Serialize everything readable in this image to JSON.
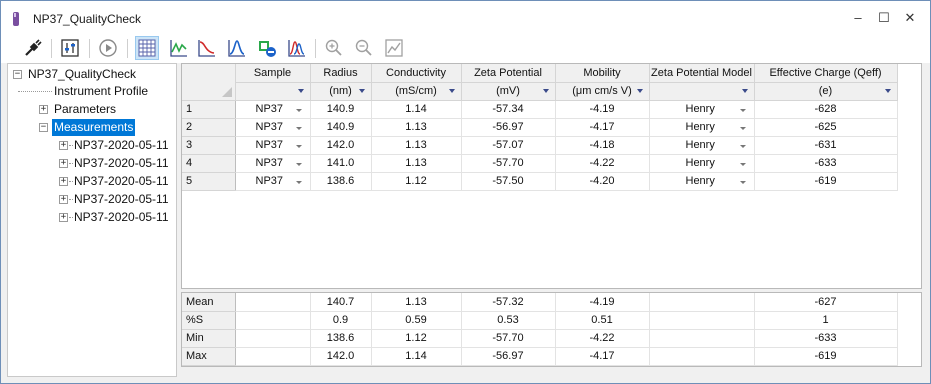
{
  "window": {
    "title": "NP37_QualityCheck",
    "minimize": "‒",
    "maximize": "☐",
    "close": "✕"
  },
  "toolbar": {
    "buttons": [
      {
        "name": "connect-icon",
        "active": false
      },
      {
        "name": "settings-sliders-icon",
        "active": false
      },
      {
        "name": "play-icon",
        "active": false
      },
      {
        "name": "grid-view-icon",
        "active": true
      },
      {
        "name": "trend-chart-icon",
        "active": false
      },
      {
        "name": "decay-chart-icon",
        "active": false
      },
      {
        "name": "peak-chart-icon",
        "active": false
      },
      {
        "name": "remove-data-icon",
        "active": false
      },
      {
        "name": "overlay-chart-icon",
        "active": false
      },
      {
        "name": "zoom-in-icon",
        "active": false
      },
      {
        "name": "zoom-out-icon",
        "active": false
      },
      {
        "name": "fit-chart-icon",
        "active": false
      }
    ]
  },
  "tree": {
    "root": "NP37_QualityCheck",
    "instrument_profile": "Instrument Profile",
    "parameters": "Parameters",
    "measurements": "Measurements",
    "measurement_items": [
      "NP37-2020-05-11",
      "NP37-2020-05-11",
      "NP37-2020-05-11",
      "NP37-2020-05-11",
      "NP37-2020-05-11"
    ]
  },
  "grid": {
    "columns": [
      "Sample",
      "Radius",
      "Conductivity",
      "Zeta Potential",
      "Mobility",
      "Zeta Potential Model",
      "Effective Charge (Qeff)"
    ],
    "units": [
      "",
      "(nm)",
      "(mS/cm)",
      "(mV)",
      "(μm cm/s V)",
      "",
      "(e)"
    ],
    "rows": [
      {
        "index": "1",
        "sample": "NP37",
        "radius": "140.9",
        "conductivity": "1.14",
        "zeta": "-57.34",
        "mobility": "-4.19",
        "model": "Henry",
        "charge": "-628"
      },
      {
        "index": "2",
        "sample": "NP37",
        "radius": "140.9",
        "conductivity": "1.13",
        "zeta": "-56.97",
        "mobility": "-4.17",
        "model": "Henry",
        "charge": "-625"
      },
      {
        "index": "3",
        "sample": "NP37",
        "radius": "142.0",
        "conductivity": "1.13",
        "zeta": "-57.07",
        "mobility": "-4.18",
        "model": "Henry",
        "charge": "-631"
      },
      {
        "index": "4",
        "sample": "NP37",
        "radius": "141.0",
        "conductivity": "1.13",
        "zeta": "-57.70",
        "mobility": "-4.22",
        "model": "Henry",
        "charge": "-633"
      },
      {
        "index": "5",
        "sample": "NP37",
        "radius": "138.6",
        "conductivity": "1.12",
        "zeta": "-57.50",
        "mobility": "-4.20",
        "model": "Henry",
        "charge": "-619"
      }
    ]
  },
  "stats": {
    "rows": [
      {
        "label": "Mean",
        "radius": "140.7",
        "conductivity": "1.13",
        "zeta": "-57.32",
        "mobility": "-4.19",
        "charge": "-627"
      },
      {
        "label": "%S",
        "radius": "0.9",
        "conductivity": "0.59",
        "zeta": "0.53",
        "mobility": "0.51",
        "charge": "1"
      },
      {
        "label": "Min",
        "radius": "138.6",
        "conductivity": "1.12",
        "zeta": "-57.70",
        "mobility": "-4.22",
        "charge": "-633"
      },
      {
        "label": "Max",
        "radius": "142.0",
        "conductivity": "1.14",
        "zeta": "-56.97",
        "mobility": "-4.17",
        "charge": "-619"
      }
    ]
  },
  "colors": {
    "selection": "#0078d7",
    "accent_caret": "#3a4a8a",
    "active_tool": "#cce4f7"
  }
}
